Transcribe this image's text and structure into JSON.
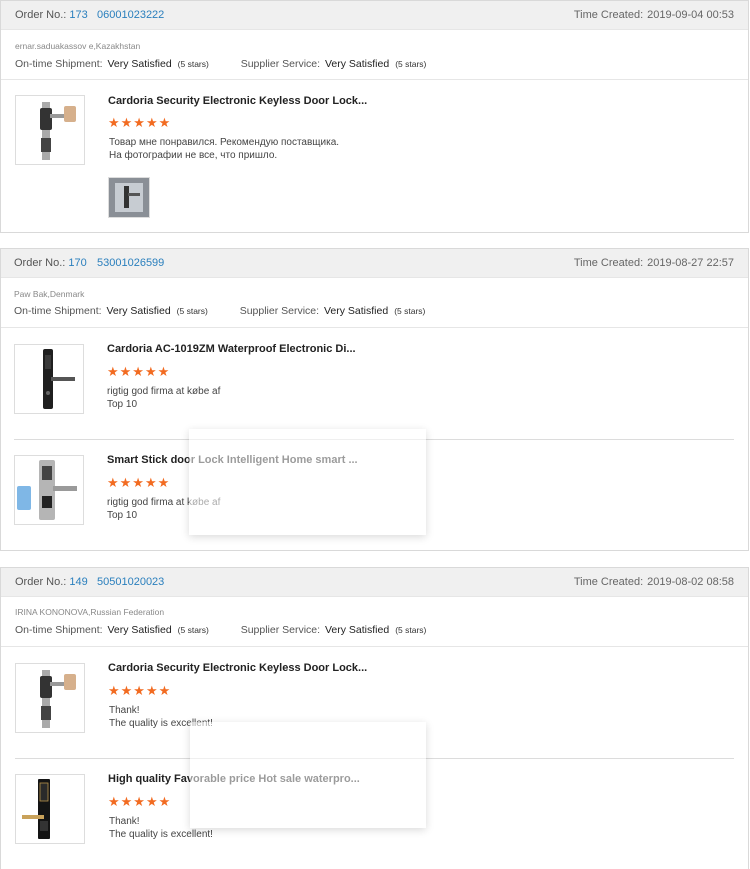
{
  "labels": {
    "order_no": "Order No.:",
    "time_created": "Time Created:",
    "ontime": "On-time Shipment:",
    "supplier": "Supplier Service:",
    "satisfied": "Very Satisfied",
    "stars_note": "(5 stars)"
  },
  "star_glyphs": "★★★★★",
  "colors": {
    "star": "#f26b21",
    "link": "#2a7fbd"
  },
  "orders": [
    {
      "number": "173",
      "tracking": "06001023222",
      "created": "2019-09-04 00:53",
      "buyer": "ernar.saduakassov e,Kazakhstan",
      "items": [
        {
          "title": "Cardoria Security Electronic Keyless Door Lock...",
          "rating": 5,
          "comment_lines": [
            "Товар мне понравился. Рекомендую поставщика.",
            "На фотографии не все, что пришло."
          ],
          "icon": "door-lock-image"
        }
      ]
    },
    {
      "number": "170",
      "tracking": "53001026599",
      "created": "2019-08-27 22:57",
      "buyer": "Paw Bak,Denmark",
      "items": [
        {
          "title": "Cardoria AC-1019ZM Waterproof Electronic Di...",
          "rating": 5,
          "comment_lines": [
            "rigtig god firma at købe af",
            "Top 10"
          ],
          "icon": "door-lock-image"
        },
        {
          "title": "Smart Stick door Lock Intelligent Home smart ...",
          "rating": 5,
          "comment_lines": [
            "rigtig god firma at købe af",
            "Top 10"
          ],
          "icon": "door-lock-image"
        }
      ]
    },
    {
      "number": "149",
      "tracking": "50501020023",
      "created": "2019-08-02 08:58",
      "buyer": "IRINA KONONOVA,Russian Federation",
      "items": [
        {
          "title": "Cardoria Security Electronic Keyless Door Lock...",
          "rating": 5,
          "comment_lines": [
            "Thank!",
            "The quality is excellent!"
          ],
          "icon": "door-lock-image"
        },
        {
          "title": "High quality Favorable price Hot sale waterpro...",
          "rating": 5,
          "comment_lines": [
            "Thank!",
            "The quality is excellent!"
          ],
          "icon": "door-lock-image"
        }
      ]
    }
  ]
}
